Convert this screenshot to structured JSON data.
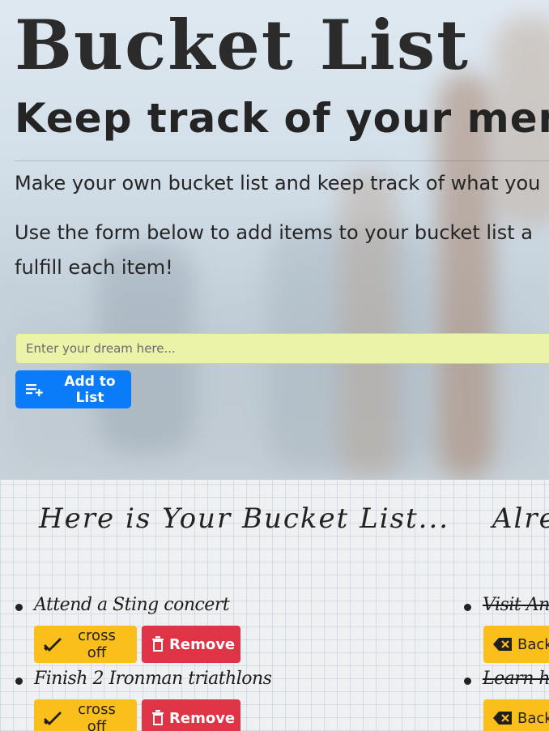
{
  "hero": {
    "title": "Bucket List",
    "subtitle": "Keep track of your memora",
    "intro": "Make your own bucket list and keep track of what you",
    "instructions": "Use the form below to add items to your bucket list a fulfill each item!"
  },
  "form": {
    "placeholder": "Enter your dream here...",
    "add_label": "Add to List",
    "add_icon": "playlist-add-icon"
  },
  "lists": {
    "todo_heading": "Here is Your Bucket List...",
    "done_heading": "Alre",
    "todo_items": [
      {
        "text": "Attend a Sting concert",
        "cross_label": "cross off",
        "remove_label": "Remove"
      },
      {
        "text": "Finish 2 Ironman triathlons",
        "cross_label": "cross off",
        "remove_label": "Remove"
      }
    ],
    "done_items": [
      {
        "text": "Visit Angl",
        "back_label": "Back"
      },
      {
        "text": "Learn how",
        "back_label": "Back"
      }
    ]
  },
  "colors": {
    "primary_button": "#0b7cf9",
    "warning_button": "#fbbf1c",
    "danger_button": "#df3446",
    "input_background": "#eaf3a7"
  }
}
